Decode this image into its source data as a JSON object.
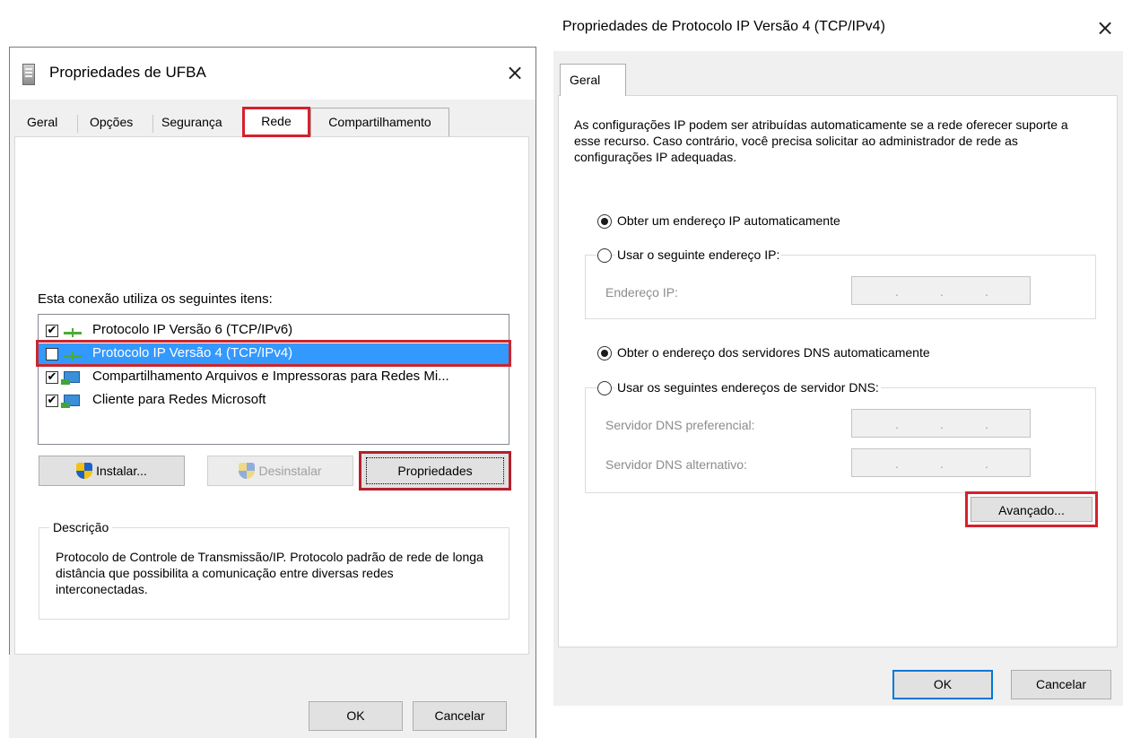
{
  "left_dialog": {
    "title": "Propriedades de UFBA",
    "close_glyph": "×",
    "tabs": [
      {
        "label": "Geral"
      },
      {
        "label": "Opções"
      },
      {
        "label": "Segurança"
      },
      {
        "label": "Rede"
      },
      {
        "label": "Compartilhamento"
      }
    ],
    "connection_label": "Esta conexão utiliza os seguintes itens:",
    "items": [
      {
        "label": "Protocolo IP Versão 6 (TCP/IPv6)",
        "checked": true,
        "icon": "network-protocol-icon"
      },
      {
        "label": "Protocolo IP Versão 4 (TCP/IPv4)",
        "checked": true,
        "icon": "network-protocol-icon",
        "selected": true
      },
      {
        "label": "Compartilhamento Arquivos e Impressoras para Redes Mi...",
        "checked": true,
        "icon": "network-share-icon"
      },
      {
        "label": "Cliente para Redes Microsoft",
        "checked": true,
        "icon": "network-client-icon"
      }
    ],
    "check_glyph": "✔",
    "buttons": {
      "instalar": "Instalar...",
      "desinstalar": "Desinstalar",
      "propriedades": "Propriedades",
      "ok": "OK",
      "cancelar": "Cancelar"
    },
    "description": {
      "title": "Descrição",
      "text": "Protocolo de Controle de Transmissão/IP. Protocolo padrão de rede de longa distância que possibilita a comunicação entre diversas redes interconectadas."
    },
    "highlight_color": "#d6202d"
  },
  "right_dialog": {
    "title": "Propriedades de Protocolo IP Versão 4 (TCP/IPv4)",
    "close_glyph": "×",
    "tab": "Geral",
    "intro": "As configurações IP podem ser atribuídas automaticamente se a rede oferecer suporte a esse recurso. Caso contrário, você precisa solicitar ao administrador de rede as configurações IP adequadas.",
    "ip_auto": "Obter um endereço IP automaticamente",
    "ip_manual": "Usar o seguinte endereço IP:",
    "ip_address_label": "Endereço IP:",
    "dns_auto": "Obter o endereço dos servidores DNS automaticamente",
    "dns_manual": "Usar os seguintes endereços de servidor DNS:",
    "dns_preferred_label": "Servidor DNS preferencial:",
    "dns_alternate_label": "Servidor DNS alternativo:",
    "ip_dots": ".",
    "buttons": {
      "avancado": "Avançado...",
      "ok": "OK",
      "cancelar": "Cancelar"
    },
    "selected_ip_mode": "auto",
    "selected_dns_mode": "auto"
  }
}
